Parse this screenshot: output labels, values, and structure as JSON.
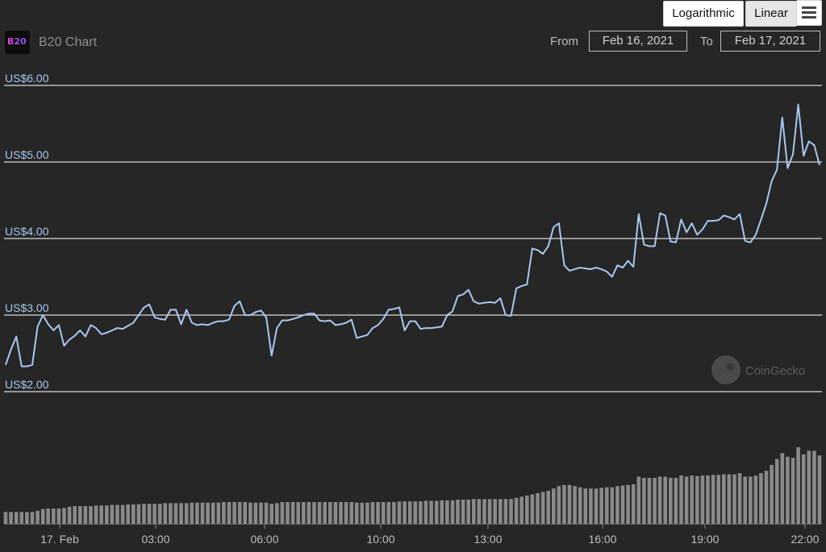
{
  "header": {
    "logo_text": "B20",
    "title": "B20 Chart",
    "scale_buttons": {
      "log_label": "Logarithmic",
      "linear_label": "Linear"
    },
    "range": {
      "from_label": "From",
      "from_value": "Feb 16, 2021",
      "to_label": "To",
      "to_value": "Feb 17, 2021"
    }
  },
  "watermark": "CoinGecko",
  "colors": {
    "background": "#262626",
    "line": "#a8c8f0",
    "grid": "#d9d9d9",
    "volume": "#8a8a8a",
    "axis_label": "#a8c8f0"
  },
  "chart_data": {
    "type": "line",
    "title": "B20 Chart",
    "xlabel": "",
    "ylabel": "",
    "scale": "linear",
    "ylim": [
      1.95,
      6.1
    ],
    "yticks": [
      2,
      3,
      4,
      5,
      6
    ],
    "ytick_labels": [
      "US$2.00",
      "US$3.00",
      "US$4.00",
      "US$5.00",
      "US$6.00"
    ],
    "xtick_labels": [
      "17. Feb",
      "03:00",
      "06:00",
      "10:00",
      "13:00",
      "16:00",
      "19:00",
      "22:00"
    ],
    "grid": true,
    "legend": "none",
    "series": [
      {
        "values": [
          2.35,
          2.55,
          2.72,
          2.33,
          2.33,
          2.35,
          2.85,
          3.0,
          2.88,
          2.8,
          2.87,
          2.6,
          2.68,
          2.73,
          2.8,
          2.72,
          2.87,
          2.83,
          2.75,
          2.77,
          2.8,
          2.83,
          2.82,
          2.86,
          2.9,
          3.0,
          3.1,
          3.14,
          2.97,
          2.95,
          2.94,
          3.07,
          3.07,
          2.88,
          3.07,
          2.9,
          2.87,
          2.88,
          2.87,
          2.9,
          2.92,
          2.92,
          2.94,
          3.12,
          3.18,
          3.0,
          3.0,
          3.04,
          3.06,
          2.97,
          2.47,
          2.83,
          2.93,
          2.93,
          2.95,
          2.97,
          3.0,
          3.02,
          3.02,
          2.93,
          2.92,
          2.93,
          2.87,
          2.88,
          2.9,
          2.94,
          2.7,
          2.72,
          2.74,
          2.83,
          2.87,
          2.95,
          3.07,
          3.08,
          3.1,
          2.8,
          2.92,
          2.92,
          2.82,
          2.83,
          2.83,
          2.84,
          2.85,
          3.0,
          3.05,
          3.25,
          3.27,
          3.33,
          3.18,
          3.15,
          3.16,
          3.17,
          3.16,
          3.22,
          3.0,
          2.99,
          3.35,
          3.38,
          3.4,
          3.87,
          3.85,
          3.8,
          3.9,
          4.15,
          4.2,
          3.65,
          3.58,
          3.6,
          3.62,
          3.61,
          3.6,
          3.62,
          3.6,
          3.57,
          3.5,
          3.65,
          3.62,
          3.71,
          3.63,
          4.32,
          3.92,
          3.9,
          3.9,
          4.33,
          4.3,
          3.96,
          3.95,
          4.25,
          4.08,
          4.2,
          4.05,
          4.12,
          4.23,
          4.23,
          4.24,
          4.3,
          4.28,
          4.25,
          4.32,
          3.97,
          3.95,
          4.05,
          4.25,
          4.46,
          4.75,
          4.9,
          5.58,
          4.92,
          5.1,
          5.75,
          5.08,
          5.27,
          5.22,
          4.96
        ]
      }
    ],
    "volume": [
      1,
      1,
      1,
      1,
      1,
      1,
      1.1,
      1.25,
      1.3,
      1.3,
      1.3,
      1.35,
      1.45,
      1.5,
      1.5,
      1.5,
      1.5,
      1.55,
      1.55,
      1.55,
      1.6,
      1.6,
      1.6,
      1.65,
      1.65,
      1.65,
      1.7,
      1.7,
      1.7,
      1.7,
      1.75,
      1.75,
      1.75,
      1.75,
      1.75,
      1.8,
      1.8,
      1.8,
      1.8,
      1.8,
      1.8,
      1.85,
      1.85,
      1.85,
      1.85,
      1.85,
      1.8,
      1.8,
      1.8,
      1.8,
      1.7,
      1.75,
      1.85,
      1.85,
      1.85,
      1.85,
      1.85,
      1.85,
      1.85,
      1.85,
      1.85,
      1.85,
      1.85,
      1.85,
      1.85,
      1.85,
      1.8,
      1.8,
      1.8,
      1.85,
      1.85,
      1.85,
      1.85,
      1.85,
      1.9,
      1.9,
      1.9,
      1.9,
      1.9,
      1.95,
      1.95,
      1.95,
      2.0,
      2.0,
      2.0,
      2.05,
      2.05,
      2.05,
      2.1,
      2.1,
      2.1,
      2.1,
      2.1,
      2.1,
      2.1,
      2.1,
      2.2,
      2.3,
      2.4,
      2.5,
      2.6,
      2.7,
      2.8,
      3.0,
      3.2,
      3.3,
      3.3,
      3.2,
      3.1,
      3.0,
      3.0,
      3.0,
      3.05,
      3.1,
      3.1,
      3.2,
      3.25,
      3.3,
      3.35,
      4.0,
      3.9,
      3.9,
      3.9,
      4.0,
      4.0,
      3.9,
      3.9,
      4.1,
      4.0,
      4.1,
      4.05,
      4.1,
      4.1,
      4.15,
      4.15,
      4.2,
      4.2,
      4.2,
      4.3,
      4.0,
      4.0,
      4.1,
      4.3,
      4.5,
      5.0,
      5.5,
      6.0,
      5.7,
      5.6,
      6.5,
      5.9,
      6.2,
      6.2,
      5.8
    ]
  }
}
